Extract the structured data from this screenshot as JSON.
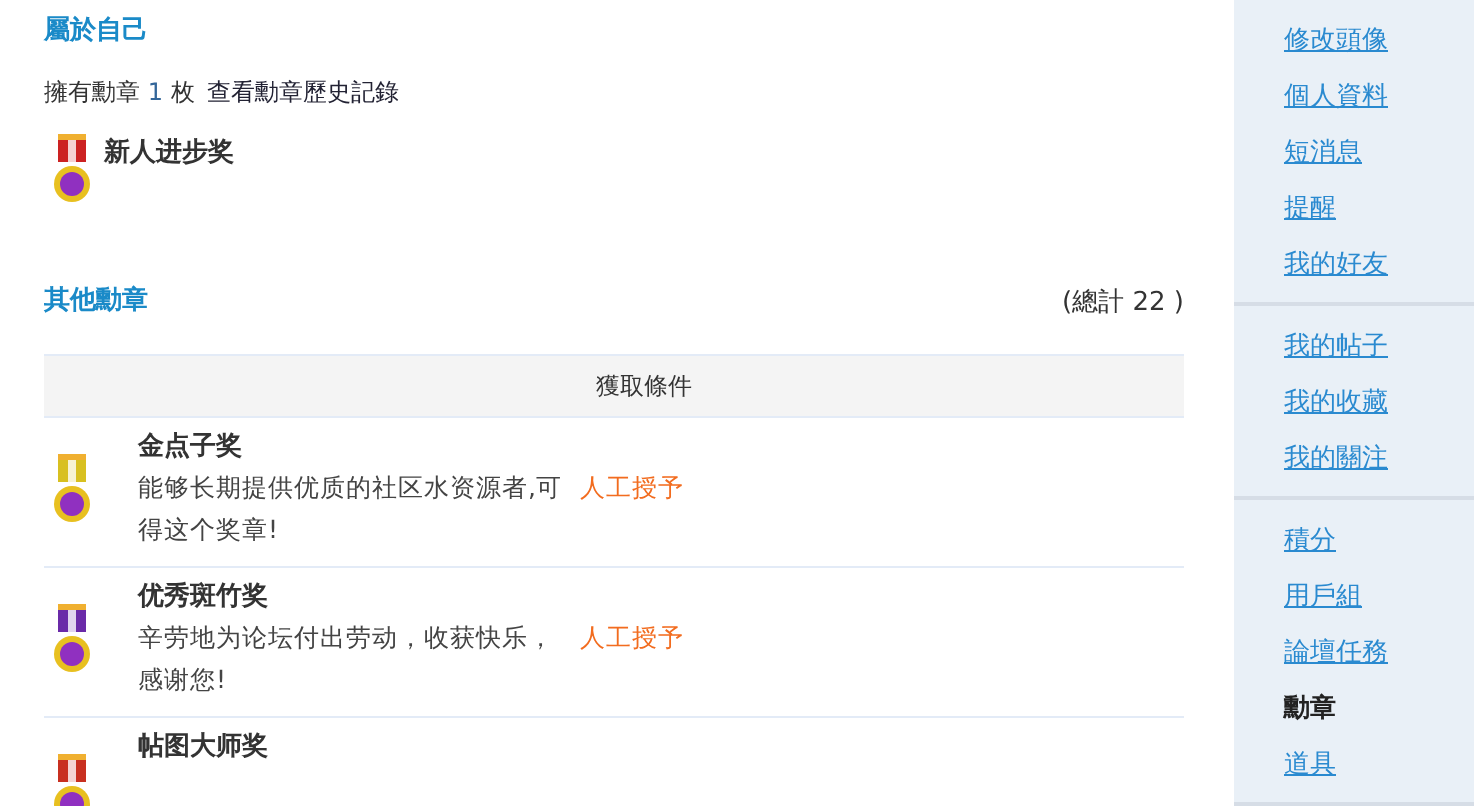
{
  "own_section": {
    "title": "屬於自己",
    "count_prefix": "擁有勳章",
    "count": "1",
    "count_suffix": "枚",
    "history_link": "查看勳章歷史記錄",
    "medals": [
      {
        "name": "新人进步奖",
        "color": "#cc2222"
      }
    ]
  },
  "other_section": {
    "title": "其他勳章",
    "total": "(總計 22 )",
    "table": {
      "columns": [
        "獲取條件"
      ],
      "rows": [
        {
          "name": "金点子奖",
          "description": "能够长期提供优质的社区水资源者,可得这个奖章!",
          "condition": "人工授予",
          "color": "#d8c020"
        },
        {
          "name": "优秀斑竹奖",
          "description": "辛劳地为论坛付出劳动，收获快乐，感谢您!",
          "condition": "人工授予",
          "color": "#6a2aa8"
        },
        {
          "name": "帖图大师奖",
          "color": "#c83020"
        }
      ]
    }
  },
  "sidebar": {
    "groups": [
      {
        "items": [
          {
            "label": "修改頭像",
            "selected": false
          },
          {
            "label": "個人資料",
            "selected": false
          },
          {
            "label": "短消息",
            "selected": false
          },
          {
            "label": "提醒",
            "selected": false
          },
          {
            "label": "我的好友",
            "selected": false
          }
        ]
      },
      {
        "items": [
          {
            "label": "我的帖子",
            "selected": false
          },
          {
            "label": "我的收藏",
            "selected": false
          },
          {
            "label": "我的關注",
            "selected": false
          }
        ]
      },
      {
        "items": [
          {
            "label": "積分",
            "selected": false
          },
          {
            "label": "用戶組",
            "selected": false
          },
          {
            "label": "論壇任務",
            "selected": false
          },
          {
            "label": "勳章",
            "selected": true
          },
          {
            "label": "道具",
            "selected": false
          }
        ]
      }
    ]
  }
}
